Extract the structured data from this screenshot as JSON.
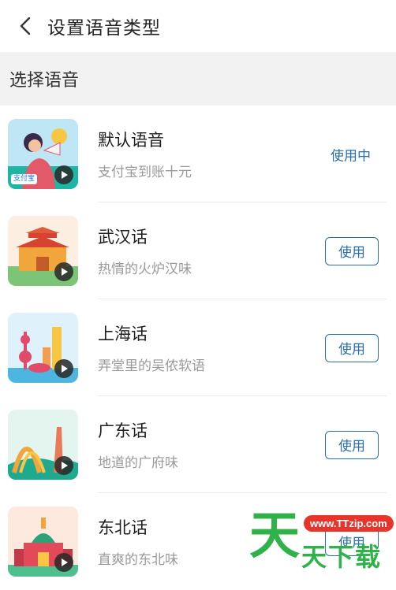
{
  "header": {
    "title": "设置语音类型"
  },
  "section": {
    "title": "选择语音"
  },
  "voices": [
    {
      "name": "默认语音",
      "desc": "支付宝到账十元",
      "status": "使用中",
      "badge": "支付宝"
    },
    {
      "name": "武汉话",
      "desc": "热情的火炉汉味",
      "status": "使用"
    },
    {
      "name": "上海话",
      "desc": "弄堂里的吴侬软语",
      "status": "使用"
    },
    {
      "name": "广东话",
      "desc": "地道的广府味",
      "status": "使用"
    },
    {
      "name": "东北话",
      "desc": "直爽的东北味",
      "status": "使用"
    }
  ],
  "watermark": {
    "url": "www.TTzip.com",
    "big": "天",
    "small": "天下载"
  },
  "colors": {
    "accent": "#2a6fa8",
    "section_bg": "#f2f2f2",
    "watermark_green": "#2fb24a",
    "watermark_red": "#e8352b"
  }
}
